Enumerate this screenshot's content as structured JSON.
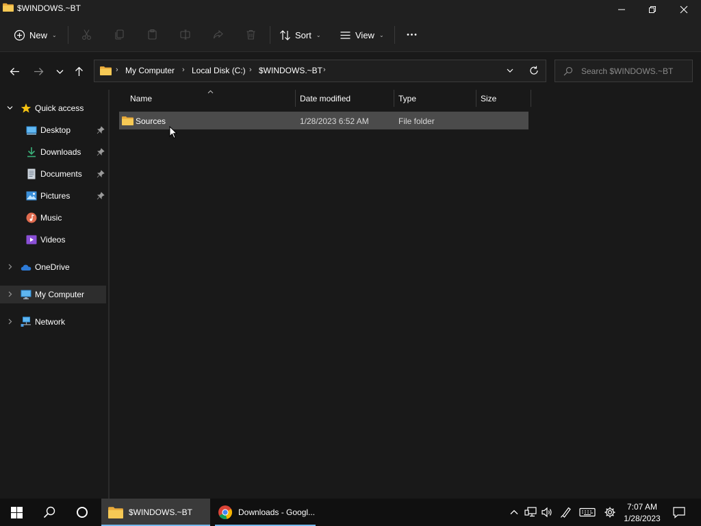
{
  "window": {
    "title": "$WINDOWS.~BT",
    "icon": "folder-icon",
    "controls": [
      "minimize-icon",
      "restore-icon",
      "close-icon"
    ]
  },
  "commandbar": {
    "new_label": "New",
    "sort_label": "Sort",
    "view_label": "View",
    "icons": [
      "plus-circle-icon",
      "cut-icon",
      "copy-icon",
      "paste-icon",
      "rename-icon",
      "share-icon",
      "delete-icon",
      "sort-icon",
      "view-icon",
      "more-icon"
    ]
  },
  "navigation": {
    "breadcrumbs": [
      "My Computer",
      "Local Disk (C:)",
      "$WINDOWS.~BT"
    ],
    "search_placeholder": "Search $WINDOWS.~BT"
  },
  "sidebar": {
    "quick_access": "Quick access",
    "items": [
      {
        "label": "Desktop",
        "icon": "desktop-icon",
        "pinned": true
      },
      {
        "label": "Downloads",
        "icon": "download-icon",
        "pinned": true
      },
      {
        "label": "Documents",
        "icon": "document-icon",
        "pinned": true
      },
      {
        "label": "Pictures",
        "icon": "pictures-icon",
        "pinned": true
      },
      {
        "label": "Music",
        "icon": "music-icon",
        "pinned": false
      },
      {
        "label": "Videos",
        "icon": "videos-icon",
        "pinned": false
      }
    ],
    "onedrive": "OneDrive",
    "my_computer": "My Computer",
    "network": "Network"
  },
  "table": {
    "columns": [
      "Name",
      "Date modified",
      "Type",
      "Size"
    ],
    "rows": [
      {
        "name": "Sources",
        "date_modified": "1/28/2023 6:52 AM",
        "type": "File folder",
        "size": ""
      }
    ]
  },
  "taskbar": {
    "apps": [
      {
        "label": "$WINDOWS.~BT",
        "icon": "folder-icon",
        "active": true
      },
      {
        "label": "Downloads - Googl...",
        "icon": "chrome-icon",
        "active": false
      }
    ],
    "time": "7:07 AM",
    "date": "1/28/2023"
  },
  "colors": {
    "background": "#191919",
    "chrome": "#202020",
    "selection": "#4b4b4b",
    "folder": "#f2c14e",
    "accent": "#76b9ed"
  }
}
